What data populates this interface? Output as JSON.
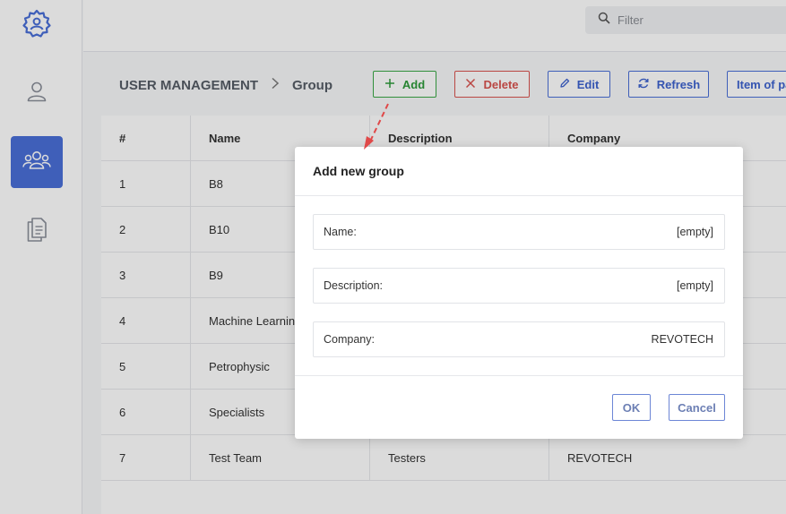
{
  "sidebar": {
    "items": [
      {
        "name": "settings",
        "icon": "gear-user-icon",
        "active": false
      },
      {
        "name": "users",
        "icon": "user-icon",
        "active": false
      },
      {
        "name": "groups",
        "icon": "users-group-icon",
        "active": true
      },
      {
        "name": "documents",
        "icon": "documents-icon",
        "active": false
      }
    ]
  },
  "topbar": {
    "filter_placeholder": "Filter"
  },
  "breadcrumb": {
    "root": "USER MANAGEMENT",
    "separator": ">",
    "current": "Group"
  },
  "toolbar": {
    "add_label": "Add",
    "delete_label": "Delete",
    "edit_label": "Edit",
    "refresh_label": "Refresh",
    "item_of_label": "Item of pa"
  },
  "table": {
    "headers": [
      "#",
      "Name",
      "Description",
      "Company"
    ],
    "rows": [
      {
        "num": "1",
        "name": "B8",
        "description": "",
        "company": ""
      },
      {
        "num": "2",
        "name": "B10",
        "description": "",
        "company": ""
      },
      {
        "num": "3",
        "name": "B9",
        "description": "",
        "company": ""
      },
      {
        "num": "4",
        "name": "Machine Learning",
        "description": "",
        "company": ""
      },
      {
        "num": "5",
        "name": "Petrophysic",
        "description": "",
        "company": ""
      },
      {
        "num": "6",
        "name": "Specialists",
        "description": "",
        "company": ""
      },
      {
        "num": "7",
        "name": "Test Team",
        "description": "Testers",
        "company": "REVOTECH"
      }
    ]
  },
  "dialog": {
    "title": "Add new group",
    "fields": [
      {
        "label": "Name:",
        "value": "[empty]"
      },
      {
        "label": "Description:",
        "value": "[empty]"
      },
      {
        "label": "Company:",
        "value": "REVOTECH"
      }
    ],
    "ok_label": "OK",
    "cancel_label": "Cancel"
  },
  "colors": {
    "accent": "#4a6fd8",
    "add_green": "#3aa845",
    "delete_red": "#d9534f",
    "annotation_arrow": "#e04848"
  }
}
